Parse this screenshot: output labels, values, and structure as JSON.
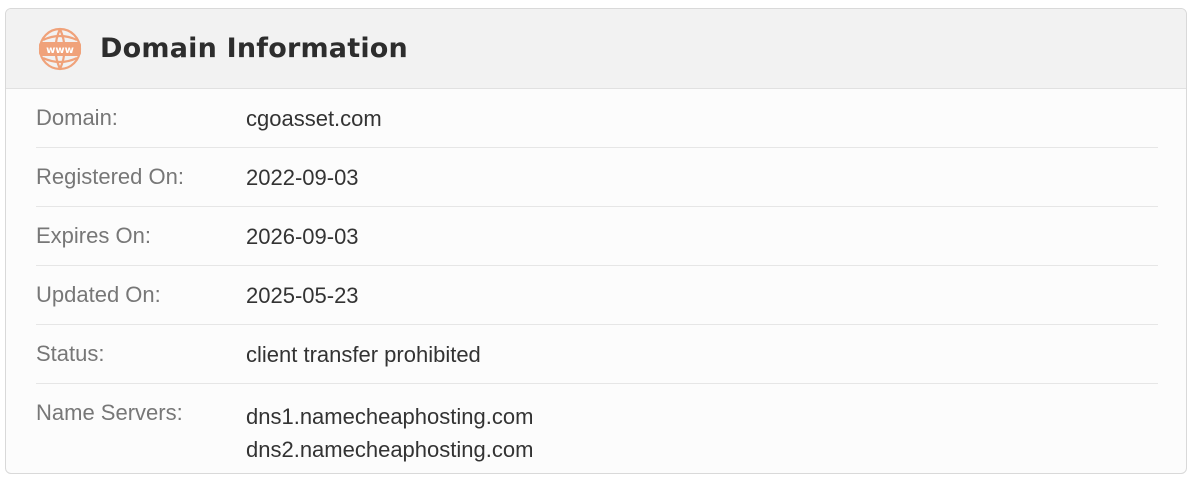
{
  "header": {
    "title": "Domain Information",
    "icon": "www-globe-icon",
    "icon_color": "#f0a27a"
  },
  "rows": [
    {
      "label": "Domain:",
      "value": "cgoasset.com"
    },
    {
      "label": "Registered On:",
      "value": "2022-09-03"
    },
    {
      "label": "Expires On:",
      "value": "2026-09-03"
    },
    {
      "label": "Updated On:",
      "value": "2025-05-23"
    },
    {
      "label": "Status:",
      "value": "client transfer prohibited"
    },
    {
      "label": "Name Servers:",
      "values": [
        "dns1.namecheaphosting.com",
        "dns2.namecheaphosting.com"
      ]
    }
  ]
}
